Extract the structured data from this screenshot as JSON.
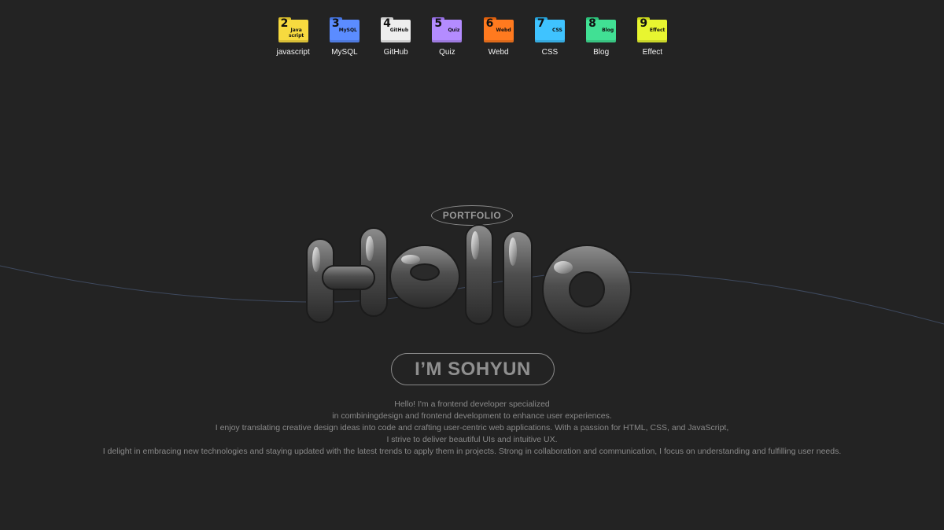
{
  "dock": {
    "items": [
      {
        "number": "2",
        "mini": "Java script",
        "label": "javascript",
        "color": "#f7da3f"
      },
      {
        "number": "3",
        "mini": "MySQL",
        "label": "MySQL",
        "color": "#5b8cff"
      },
      {
        "number": "4",
        "mini": "GitHub",
        "label": "GitHub",
        "color": "#eeeeee"
      },
      {
        "number": "5",
        "mini": "Quiz",
        "label": "Quiz",
        "color": "#b48cff"
      },
      {
        "number": "6",
        "mini": "Webd",
        "label": "Webd",
        "color": "#ff7a1f"
      },
      {
        "number": "7",
        "mini": "CSS",
        "label": "CSS",
        "color": "#3fc3ff"
      },
      {
        "number": "8",
        "mini": "Blog",
        "label": "Blog",
        "color": "#41e094"
      },
      {
        "number": "9",
        "mini": "Effect",
        "label": "Effect",
        "color": "#e8f530"
      }
    ]
  },
  "hero": {
    "badge": "PORTFOLIO",
    "headline": "Hello",
    "name": "I’M SOHYUN"
  },
  "intro": {
    "lines": [
      "Hello! I'm a frontend developer specialized",
      "in combiningdesign and frontend development to enhance user experiences.",
      "I enjoy translating creative design ideas into code and crafting user-centric web applications. With a passion for HTML, CSS, and JavaScript,",
      "I strive to deliver beautiful UIs and intuitive UX.",
      "I delight in embracing new technologies and staying updated with the latest trends to apply them in projects. Strong in collaboration and communication, I focus on understanding and fulfilling user needs."
    ]
  },
  "colors": {
    "background": "#232323",
    "muted_text": "#8a8a8a",
    "balloon": "#5a5a5a"
  }
}
